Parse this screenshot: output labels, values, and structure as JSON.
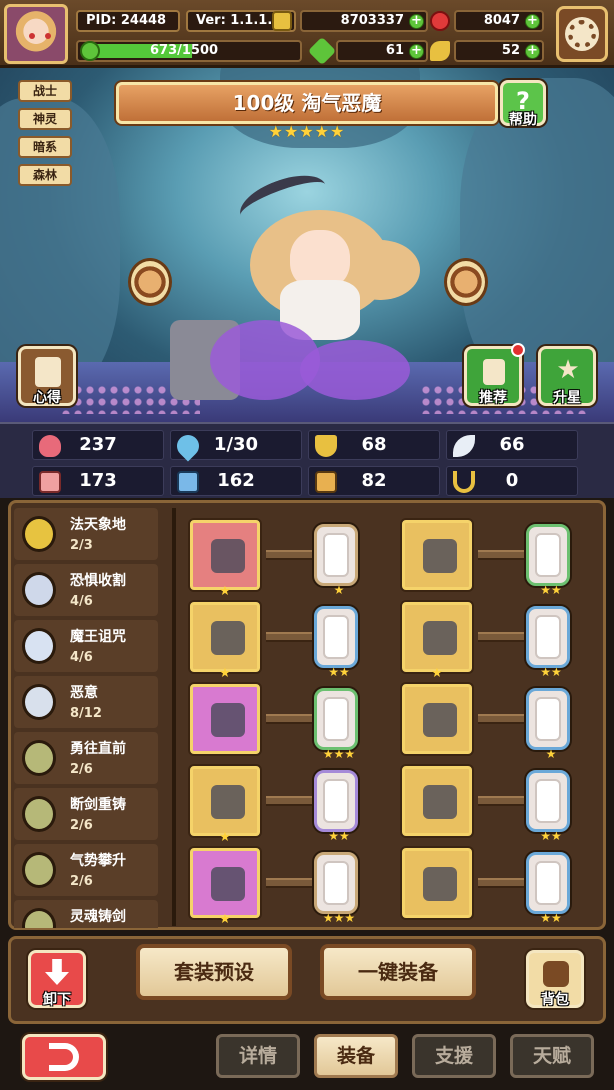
{
  "header": {
    "pid": "PID: 24448",
    "version": "Ver: 1.1.1.0",
    "gold": "8703337",
    "gems": "8047",
    "exp": "673/1500",
    "clover": "61",
    "keys": "52"
  },
  "hero": {
    "title": "100级 淘气恶魔",
    "stars": "★★★★★",
    "tags": [
      "战士",
      "神灵",
      "暗系",
      "森林"
    ],
    "help_label": "帮助",
    "insight_label": "心得",
    "recommend_label": "推荐",
    "starup_label": "升星"
  },
  "stats": {
    "row1": [
      "237",
      "1/30",
      "68",
      "66"
    ],
    "row2": [
      "173",
      "162",
      "82",
      "0"
    ]
  },
  "skills": [
    {
      "name": "法天象地",
      "progress": "2/3",
      "color": "#e7c340"
    },
    {
      "name": "恐惧收割",
      "progress": "4/6",
      "color": "#cfd8ea"
    },
    {
      "name": "魔王诅咒",
      "progress": "4/6",
      "color": "#d8e2f2"
    },
    {
      "name": "恶意",
      "progress": "8/12",
      "color": "#d8e0ec"
    },
    {
      "name": "勇往直前",
      "progress": "2/6",
      "color": "#b6b878"
    },
    {
      "name": "断剑重铸",
      "progress": "2/6",
      "color": "#b6b878"
    },
    {
      "name": "气势攀升",
      "progress": "2/6",
      "color": "#b6b878"
    },
    {
      "name": "灵魂铸剑",
      "progress": "",
      "color": "#b6b878"
    }
  ],
  "equipment": [
    {
      "bg": "#e58080",
      "stars": "★",
      "card": "#c8a878",
      "cstars": "★"
    },
    {
      "bg": "#e9c060",
      "stars": "",
      "card": "#6cc070",
      "cstars": "★★"
    },
    {
      "bg": "#e9c060",
      "stars": "★",
      "card": "#6aa8d8",
      "cstars": "★★"
    },
    {
      "bg": "#e9c060",
      "stars": "★",
      "card": "#6aa8d8",
      "cstars": "★★"
    },
    {
      "bg": "#d87ad0",
      "stars": "",
      "card": "#6cc070",
      "cstars": "★★★"
    },
    {
      "bg": "#e9c060",
      "stars": "",
      "card": "#6aa8d8",
      "cstars": "★"
    },
    {
      "bg": "#e9c060",
      "stars": "★",
      "card": "#a58ad8",
      "cstars": "★★"
    },
    {
      "bg": "#e9c060",
      "stars": "",
      "card": "#6aa8d8",
      "cstars": "★★"
    },
    {
      "bg": "#d87ad0",
      "stars": "★",
      "card": "#c8a878",
      "cstars": "★★★"
    },
    {
      "bg": "#e9c060",
      "stars": "",
      "card": "#6aa8d8",
      "cstars": "★★"
    }
  ],
  "actions": {
    "unequip_label": "卸下",
    "preset_label": "套装预设",
    "oneclick_label": "一键装备",
    "bag_label": "背包"
  },
  "nav": {
    "tabs": [
      "详情",
      "装备",
      "支援",
      "天赋"
    ],
    "active": "装备"
  },
  "colors": {
    "accent": "#e8c070",
    "primary_bg": "#4a3220"
  }
}
